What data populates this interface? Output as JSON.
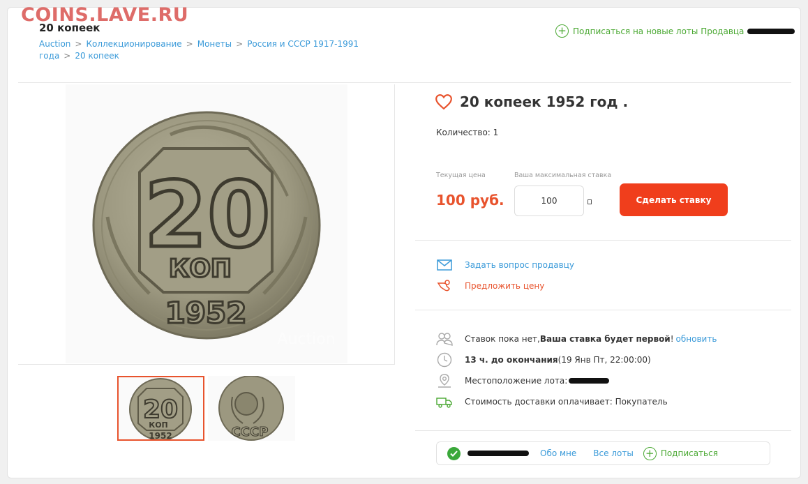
{
  "watermark": "COINS.LAVE.RU",
  "header": {
    "title": "20 копеек",
    "breadcrumb": [
      "Auction",
      "Коллекционирование",
      "Монеты",
      "Россия и СССР 1917-1991 года",
      "20 копеек"
    ],
    "subscribe_label": "Подписаться на новые лоты Продавца"
  },
  "photo": {
    "denomination": "20",
    "unit": "КОП",
    "year": "1952",
    "overlay_text": "Auction",
    "reverse_letters": "СССР"
  },
  "lot": {
    "title": "20 копеек 1952 год .",
    "quantity": "Количество: 1",
    "current_price_label": "Текущая цена",
    "current_price": "100 руб.",
    "max_bid_label": "Ваша максимальная ставка",
    "max_bid_value": "100",
    "bid_button": "Сделать ставку"
  },
  "actions": {
    "ask_seller": "Задать вопрос продавцу",
    "offer_price": "Предложить цену"
  },
  "info": {
    "bids_prefix": "Ставок пока нет, ",
    "bids_bold": "Ваша ставка будет первой",
    "bids_suffix": "! ",
    "refresh_link": "обновить",
    "time_bold": "13 ч. до окончания",
    "time_detail": " (19 Янв Пт, 22:00:00)",
    "location_label": "Местоположение лота: ",
    "shipping": "Стоимость доставки оплачивает: Покупатель"
  },
  "seller": {
    "about": "Обо мне",
    "all_lots": "Все лоты",
    "subscribe": "Подписаться"
  },
  "colors": {
    "accent_orange": "#f03e1c",
    "price_red": "#e8532d",
    "link_blue": "#3a9ad9",
    "green": "#4aa832"
  }
}
